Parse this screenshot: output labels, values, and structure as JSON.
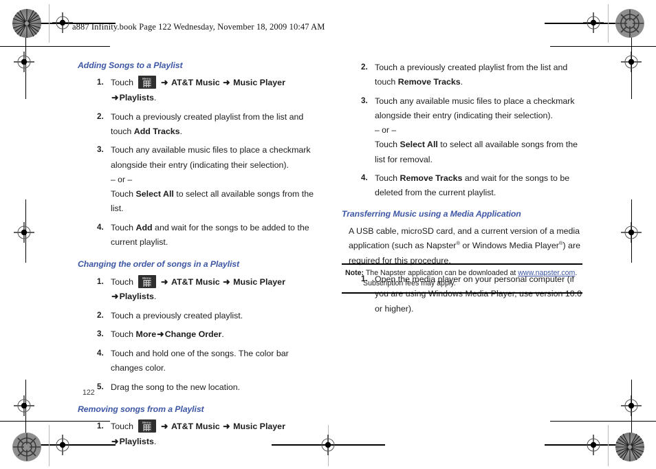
{
  "page": {
    "header": "a887 Infinity.book  Page 122  Wednesday, November 18, 2009  10:47 AM",
    "number": "122",
    "accent_blue": "#3d57a4",
    "menu_key_label": "Menu",
    "arrow_glyph": "➜"
  },
  "left_column": {
    "sections": [
      {
        "heading": "Adding Songs to a Playlist",
        "steps": [
          {
            "num": "1.",
            "prefix": "Touch ",
            "has_menu_icon": true,
            "nav": [
              "AT&T Music",
              "Music Player",
              "Playlists"
            ],
            "suffix": "."
          },
          {
            "num": "2.",
            "text_a": "Touch a previously created playlist from the list and touch ",
            "bold_b": "Add Tracks",
            "text_c": "."
          },
          {
            "num": "3.",
            "text_a": "Touch any available music files to place a checkmark alongside their entry (indicating their selection).",
            "or_line": "– or –",
            "alt_a": "Touch ",
            "alt_bold": "Select All",
            "alt_c": " to select all available songs from the list."
          },
          {
            "num": "4.",
            "text_a": "Touch ",
            "bold_b": "Add",
            "text_c": " and wait for the songs to be added to the current playlist."
          }
        ]
      },
      {
        "heading": "Changing the order of songs in a Playlist",
        "steps": [
          {
            "num": "1.",
            "prefix": "Touch ",
            "has_menu_icon": true,
            "nav": [
              "AT&T Music",
              "Music Player",
              "Playlists"
            ],
            "suffix": "."
          },
          {
            "num": "2.",
            "text_a": "Touch a previously created playlist."
          },
          {
            "num": "3.",
            "text_a": "Touch ",
            "bold_b": "More",
            "bold_c": "Change Order",
            "text_d": "."
          },
          {
            "num": "4.",
            "text_a": "Touch and hold one of the songs. The color bar changes color."
          },
          {
            "num": "5.",
            "text_a": "Drag the song to the new location."
          }
        ]
      },
      {
        "heading": "Removing songs from a Playlist",
        "steps": [
          {
            "num": "1.",
            "prefix": "Touch ",
            "has_menu_icon": true,
            "nav": [
              "AT&T Music",
              "Music Player",
              "Playlists"
            ],
            "suffix": "."
          }
        ]
      }
    ]
  },
  "right_column": {
    "continued_steps": [
      {
        "num": "2.",
        "text_a": "Touch a previously created playlist from the list and touch ",
        "bold_b": "Remove Tracks",
        "text_c": "."
      },
      {
        "num": "3.",
        "text_a": "Touch any available music files to place a checkmark alongside their entry (indicating their selection).",
        "or_line": "– or –",
        "alt_a": "Touch ",
        "alt_bold": "Select All",
        "alt_c": " to select all available songs from the list for removal."
      },
      {
        "num": "4.",
        "text_a": "Touch ",
        "bold_b": "Remove Tracks",
        "text_c": " and wait for the songs to be deleted from the current playlist."
      }
    ],
    "section": {
      "heading": "Transferring Music using a Media Application",
      "intro_a": "A USB cable, microSD card, and a current version of a media application (such as Napster",
      "intro_b": " or Windows Media Player",
      "intro_c": ") are required for this procedure.",
      "steps": [
        {
          "num": "1.",
          "text_a": "Open the media player on your personal computer (if you are using Windows Media Player, use version 10.0 or higher)."
        }
      ]
    },
    "note": {
      "label": "Note:",
      "text_a": " The Napster application can be downloaded at ",
      "link": "www.napster.com",
      "text_b": ".",
      "line2": "Subscription fees may apply."
    }
  }
}
